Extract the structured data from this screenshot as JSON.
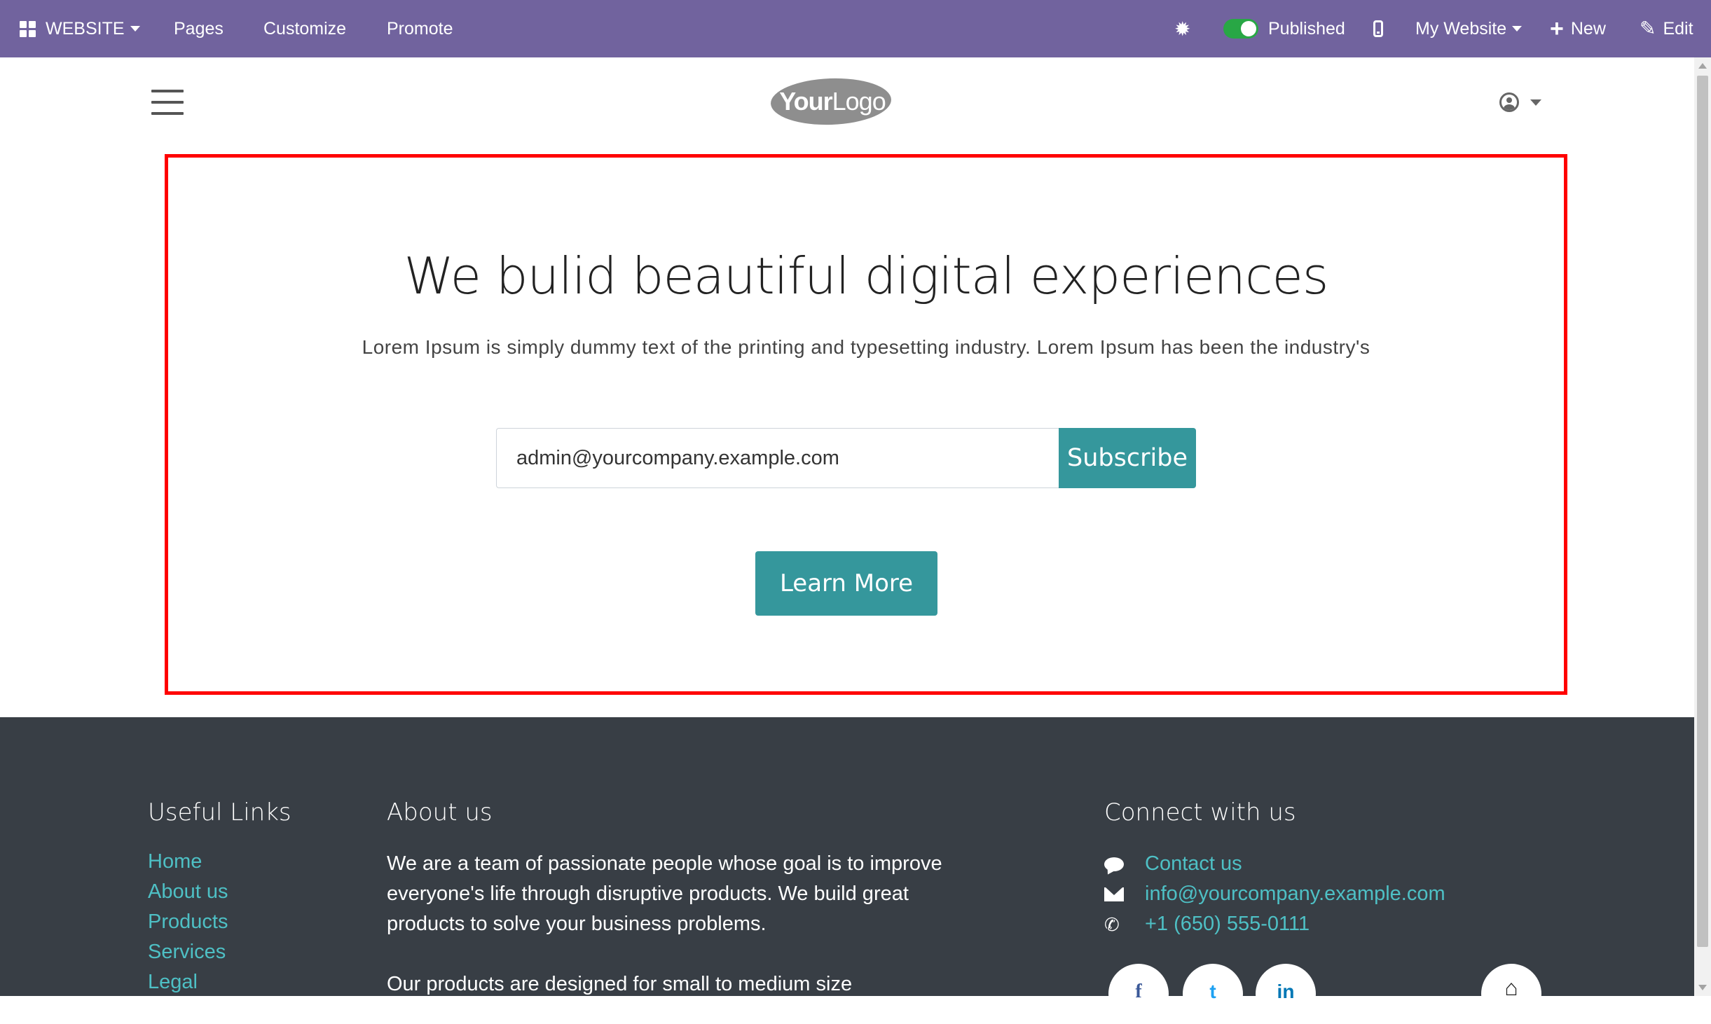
{
  "topbar": {
    "app_label": "WEBSITE",
    "menu": [
      "Pages",
      "Customize",
      "Promote"
    ],
    "published_label": "Published",
    "website_selector": "My Website",
    "new_label": "New",
    "edit_label": "Edit"
  },
  "header": {
    "logo_bold": "Your",
    "logo_light": "Logo"
  },
  "hero": {
    "title": "We bulid beautiful digital experiences",
    "subtitle": "Lorem Ipsum is simply dummy text of the printing and typesetting industry. Lorem Ipsum has been the industry's",
    "email_value": "admin@yourcompany.example.com",
    "subscribe_label": "Subscribe",
    "learn_more_label": "Learn More"
  },
  "footer": {
    "useful_links_heading": "Useful Links",
    "useful_links": [
      "Home",
      "About us",
      "Products",
      "Services",
      "Legal"
    ],
    "about_heading": "About us",
    "about_paragraphs": [
      "We are a team of passionate people whose goal is to improve everyone's life through disruptive products. We build great products to solve your business problems.",
      "Our products are designed for small to medium size"
    ],
    "connect_heading": "Connect with us",
    "contacts": [
      {
        "icon": "comment-icon",
        "label": "Contact us"
      },
      {
        "icon": "envelope-icon",
        "label": "info@yourcompany.example.com"
      },
      {
        "icon": "phone-icon",
        "label": "+1 (650) 555-0111"
      }
    ],
    "social": [
      {
        "icon": "facebook-icon",
        "glyph": "f"
      },
      {
        "icon": "twitter-icon",
        "glyph": "t"
      },
      {
        "icon": "linkedin-icon",
        "glyph": "in"
      },
      {
        "icon": "home-icon",
        "glyph": "⌂"
      }
    ]
  },
  "colors": {
    "topbar": "#71639e",
    "accent": "#35979c",
    "footer_bg": "#383e45",
    "footer_link": "#4ec0c5",
    "highlight_border": "#ff0000"
  }
}
